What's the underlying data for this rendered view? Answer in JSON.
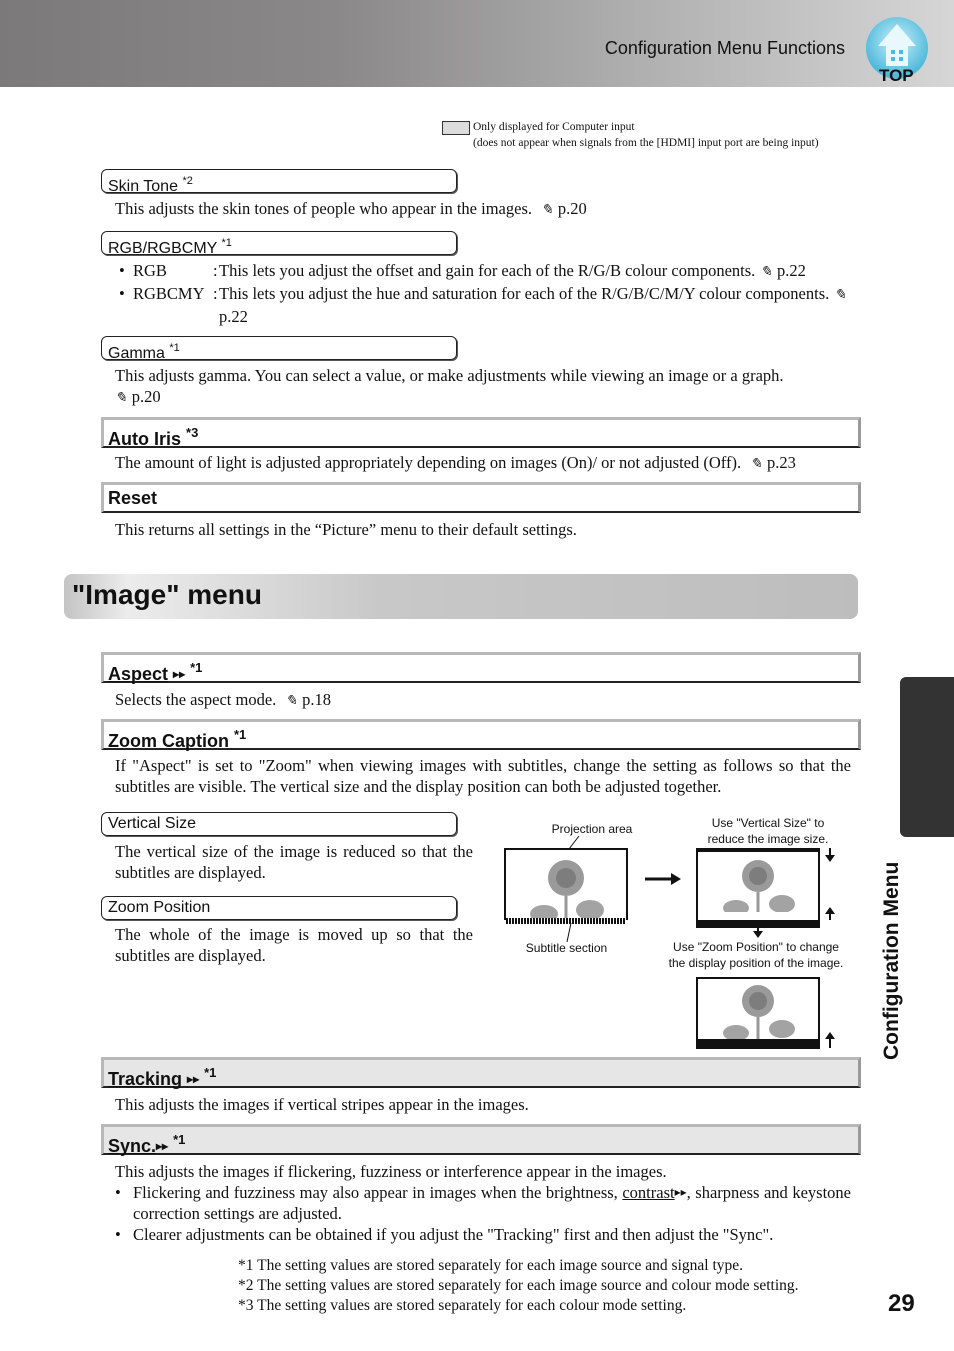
{
  "header": {
    "title": "Configuration Menu Functions",
    "top_button_label": "TOP"
  },
  "legend": {
    "line1": "Only displayed for Computer input",
    "line2": "(does not appear when signals from the [HDMI] input port are being input)"
  },
  "picture_items": {
    "skin_tone": {
      "title": "Skin Tone",
      "note": "*2",
      "text": "This adjusts the skin tones of people who appear in the images.",
      "ref": "p.20"
    },
    "rgb": {
      "title": "RGB/RGBCMY",
      "note": "*1",
      "bullets": [
        {
          "term": "RGB",
          "text": "This lets you adjust the offset and gain for each of the R/G/B colour components.",
          "ref": "p.22"
        },
        {
          "term": "RGBCMY",
          "text": "This lets you adjust the hue and saturation for each of the R/G/B/C/M/Y colour components.",
          "ref": "p.22"
        }
      ]
    },
    "gamma": {
      "title": "Gamma",
      "note": "*1",
      "text": "This adjusts gamma. You can select a value, or make adjustments while viewing an image or a graph.",
      "ref": "p.20"
    },
    "auto_iris": {
      "title": "Auto Iris",
      "note": "*3",
      "text": "The amount of light is adjusted appropriately depending on images (On)/ or not adjusted (Off).",
      "ref": "p.23"
    },
    "reset": {
      "title": "Reset",
      "text": "This returns all settings in the “Picture” menu to their default settings."
    }
  },
  "image_menu": {
    "title": "\"Image\" menu",
    "aspect": {
      "title": "Aspect",
      "note": "*1",
      "text": "Selects the aspect mode.",
      "ref": "p.18"
    },
    "zoom_caption": {
      "title": "Zoom Caption",
      "note": "*1",
      "text": "If \"Aspect\" is set to \"Zoom\" when viewing images with subtitles, change the setting as follows so that the subtitles are visible. The vertical size and the display position can both be adjusted together.",
      "vertical_size": {
        "title": "Vertical Size",
        "text": "The vertical size of the image is reduced so that the subtitles are displayed."
      },
      "zoom_position": {
        "title": "Zoom Position",
        "text": "The whole of the image is moved up so that the subtitles are displayed."
      },
      "figure": {
        "projection_area": "Projection area",
        "subtitle_section": "Subtitle section",
        "vertical_note_1": "Use \"Vertical Size\" to",
        "vertical_note_2": "reduce the image size.",
        "position_note_1": "Use \"Zoom Position\" to change",
        "position_note_2": "the display position of the image."
      }
    },
    "tracking": {
      "title": "Tracking",
      "note": "*1",
      "text": "This adjusts the images if vertical stripes appear in the images."
    },
    "sync": {
      "title": "Sync.",
      "note": "*1",
      "text": "This adjusts the images if flickering, fuzziness or interference appear in the images.",
      "bullet1_a": "Flickering and fuzziness may also appear in images when the brightness,",
      "bullet1_link": "contrast",
      "bullet1_b": ", sharpness and keystone correction settings are adjusted.",
      "bullet2": "Clearer adjustments can be obtained if you adjust the \"Tracking\" first and then adjust the \"Sync\"."
    }
  },
  "footnotes": [
    "*1  The setting values are stored separately for each image source and signal type.",
    "*2  The setting values are stored separately for each image source and colour mode setting.",
    "*3  The setting values are stored separately for each colour mode setting."
  ],
  "side_tab": {
    "label": "Configuration Menu"
  },
  "page_number": "29",
  "colors": {
    "header_dark": "#7b7979",
    "header_light": "#d6d6d6",
    "top_icon": "#5fc6e3",
    "side_tab": "#333333",
    "heading_fill": "#e6e6e6"
  }
}
